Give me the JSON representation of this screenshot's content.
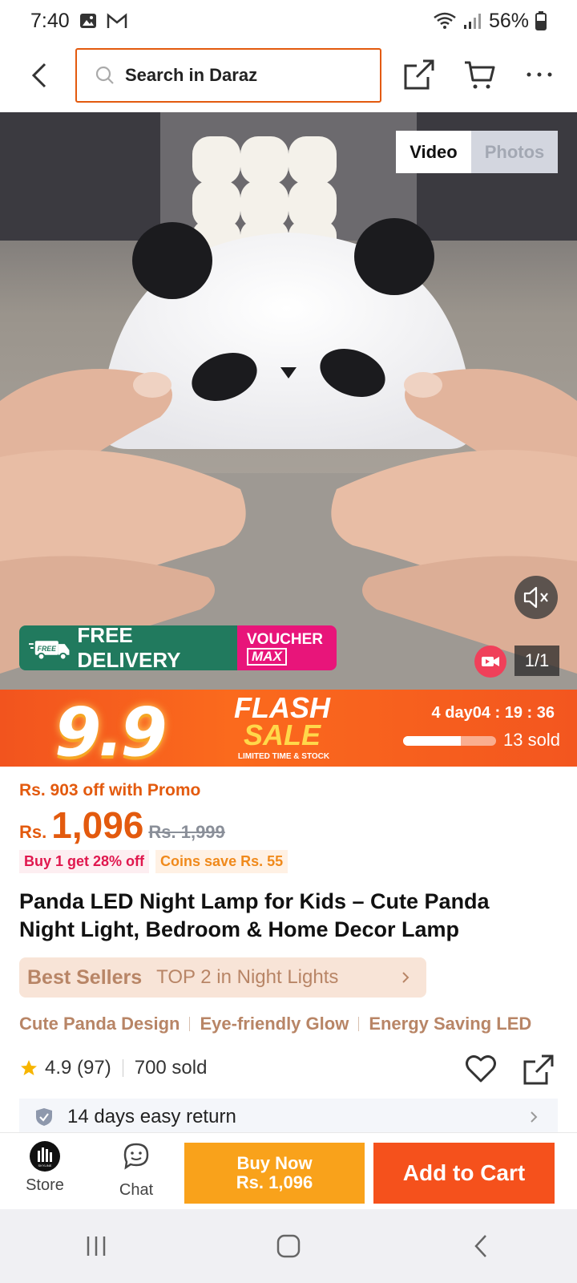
{
  "status_bar": {
    "time": "7:40",
    "battery": "56%"
  },
  "header": {
    "search_placeholder": "Search in Daraz"
  },
  "media": {
    "tabs": [
      "Video",
      "Photos"
    ],
    "active_tab": "Video",
    "free_delivery": "FREE DELIVERY",
    "free_badge": "FREE",
    "voucher_line1": "VOUCHER",
    "voucher_line2": "MAX",
    "counter": "1/1"
  },
  "flash_sale": {
    "badge": "9.9",
    "flash": "FLASH",
    "sale": "SALE",
    "subtitle": "LIMITED TIME & STOCK",
    "days": "4 day",
    "time": "04 : 19 : 36",
    "sold_progress": 0.62,
    "sold": "13 sold"
  },
  "pricing": {
    "promo": "Rs. 903 off with Promo",
    "currency": "Rs.",
    "price": "1,096",
    "old_price": "Rs. 1,999",
    "tag1": "Buy 1 get 28% off",
    "tag2": "Coins save Rs. 55"
  },
  "product": {
    "title": "Panda LED Night Lamp for Kids – Cute Panda Night Light, Bedroom & Home Decor Lamp",
    "best_sellers": "Best Sellers",
    "best_rank": "TOP 2 in Night Lights",
    "features": [
      "Cute Panda Design",
      "Eye-friendly Glow",
      "Energy Saving LED"
    ],
    "rating": "4.9 (97)",
    "sold": "700 sold",
    "returns": "14 days easy return"
  },
  "action_bar": {
    "store": "Store",
    "store_logo_text": "SKYLINE",
    "chat": "Chat",
    "buy_now_line1": "Buy Now",
    "buy_now_line2": "Rs. 1,096",
    "add_to_cart": "Add to Cart"
  },
  "colors": {
    "accent": "#f5511c",
    "buy_now": "#f9a21b",
    "search_border": "#e35a0e",
    "delivery_green": "#217a5e",
    "voucher_pink": "#e8157a"
  }
}
